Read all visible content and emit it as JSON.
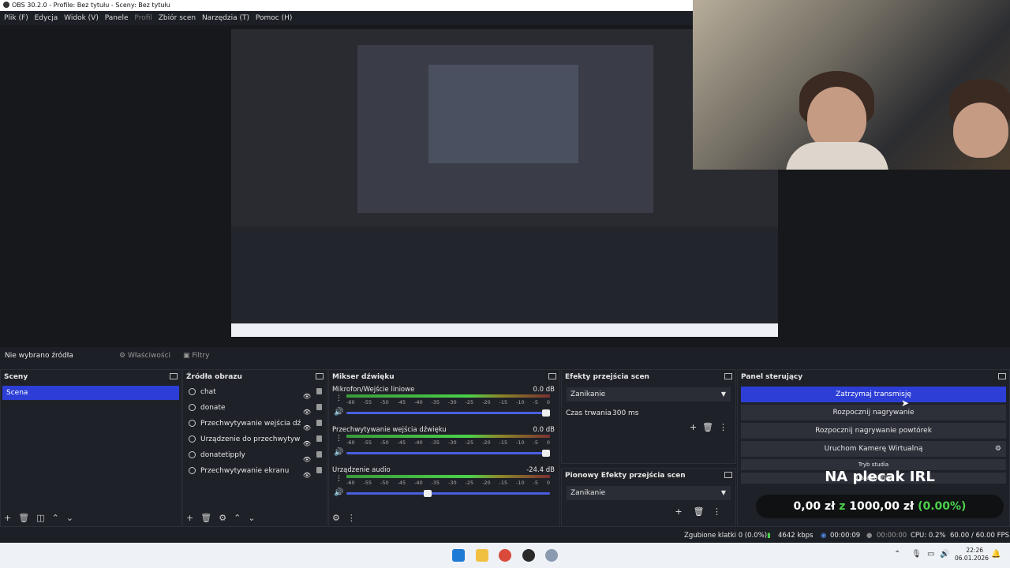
{
  "titlebar": {
    "text": "OBS 30.2.0 - Profile: Bez tytułu - Sceny: Bez tytułu"
  },
  "menu": [
    "Plik (F)",
    "Edycja",
    "Widok (V)",
    "Panele",
    "Profil",
    "Zbiór scen",
    "Narzędzia (T)",
    "Pomoc (H)"
  ],
  "statusrow": {
    "no_source": "Nie wybrano źródła",
    "properties": "Właściwości",
    "filters": "Filtry"
  },
  "scenes": {
    "title": "Sceny",
    "items": [
      "Scena"
    ]
  },
  "sources": {
    "title": "Źródła obrazu",
    "items": [
      {
        "label": "chat",
        "icon": "globe-icon"
      },
      {
        "label": "donate",
        "icon": "globe-icon"
      },
      {
        "label": "Przechwytywanie wejścia dź",
        "icon": "mic-icon"
      },
      {
        "label": "Urządzenie do przechwytyw",
        "icon": "camera-icon"
      },
      {
        "label": "donatetipply",
        "icon": "globe-icon"
      },
      {
        "label": "Przechwytywanie ekranu",
        "icon": "monitor-icon"
      }
    ]
  },
  "mixer": {
    "title": "Mikser dźwięku",
    "channels": [
      {
        "name": "Mikrofon/Wejście liniowe",
        "db": "0.0 dB",
        "level": 0.0,
        "volume": 1.0
      },
      {
        "name": "Przechwytywanie wejścia dźwięku",
        "db": "0.0 dB",
        "level": 0.0,
        "volume": 1.0
      },
      {
        "name": "Urządzenie audio",
        "db": "-24.4 dB",
        "level": 0.0,
        "volume": 0.42
      }
    ],
    "ticks": [
      "-60",
      "-55",
      "-50",
      "-45",
      "-40",
      "-35",
      "-30",
      "-25",
      "-20",
      "-15",
      "-10",
      "-5",
      "0"
    ]
  },
  "transitions": {
    "title": "Efekty przejścia scen",
    "selected": "Zanikanie",
    "duration_label": "Czas trwania",
    "duration": "300 ms"
  },
  "vertical_transitions": {
    "title": "Pionowy Efekty przejścia scen",
    "selected": "Zanikanie"
  },
  "controls": {
    "title": "Panel sterujący",
    "stop_stream": "Zatrzymaj transmisję",
    "start_record": "Rozpocznij nagrywanie",
    "start_replay": "Rozpocznij nagrywanie powtórek",
    "virtual_cam": "Uruchom Kamerę Wirtualną",
    "studio_mode": "Tryb studia",
    "settings": "Ustawienia"
  },
  "overlay": {
    "title": "NA plecak IRL",
    "current": "0,00 zł",
    "sep": "z",
    "goal": "1000,00 zł",
    "pct": "(0.00%)"
  },
  "statusbar": {
    "dropped": "Zgubione klatki 0 (0.0%)",
    "bitrate": "4642 kbps",
    "stream_time": "00:00:09",
    "rec_time": "00:00:00",
    "cpu": "CPU: 0.2%",
    "fps": "60.00 / 60.00 FPS"
  },
  "clock": {
    "time": "22:26",
    "date": "06.01.2026"
  },
  "colors": {
    "accent": "#2c3ed6",
    "green": "#4bd14b"
  }
}
